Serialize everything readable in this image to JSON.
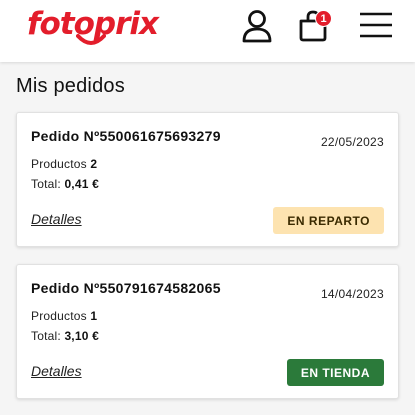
{
  "header": {
    "logo_text": "fotoprix",
    "cart_count": "1",
    "brand_color": "#e31d2b",
    "icons": [
      "user-icon",
      "shopping-bag-icon",
      "hamburger-menu-icon"
    ]
  },
  "page": {
    "title": "Mis pedidos"
  },
  "orders": [
    {
      "title": "Pedido Nº550061675693279",
      "date": "22/05/2023",
      "products_label": "Productos",
      "products_count": "2",
      "total_label": "Total:",
      "total_value": "0,41 €",
      "details_label": "Detalles",
      "status": "EN REPARTO",
      "status_bg": "#fde3b0",
      "status_fg": "#3a2a00"
    },
    {
      "title": "Pedido Nº550791674582065",
      "date": "14/04/2023",
      "products_label": "Productos",
      "products_count": "1",
      "total_label": "Total:",
      "total_value": "3,10 €",
      "details_label": "Detalles",
      "status": "EN TIENDA",
      "status_bg": "#2b7a3a",
      "status_fg": "#ffffff"
    }
  ]
}
